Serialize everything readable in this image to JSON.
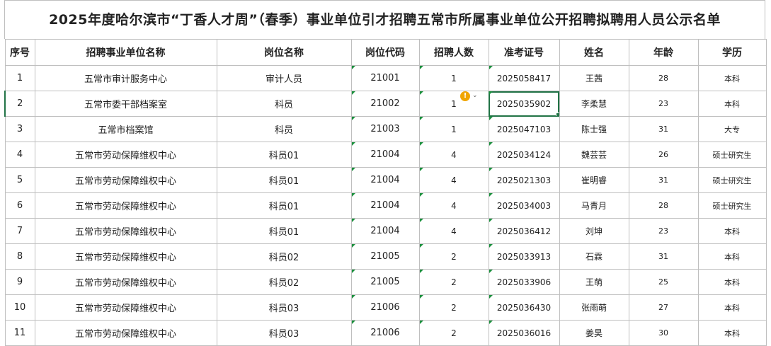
{
  "title": "2025年度哈尔滨市“丁香人才周”（春季）事业单位引才招聘五常市所属事业单位公开招聘拟聘用人员公示名单",
  "headers": [
    "序号",
    "招聘事业单位名称",
    "岗位名称",
    "岗位代码",
    "招聘人数",
    "准考证号",
    "姓名",
    "年龄",
    "学历"
  ],
  "rows": [
    [
      "1",
      "五常市审计服务中心",
      "审计人员",
      "21001",
      "1",
      "2025058417",
      "王茜",
      "28",
      "本科"
    ],
    [
      "2",
      "五常市委干部档案室",
      "科员",
      "21002",
      "1",
      "2025035902",
      "李柔慧",
      "23",
      "本科"
    ],
    [
      "3",
      "五常市档案馆",
      "科员",
      "21003",
      "1",
      "2025047103",
      "陈士强",
      "31",
      "大专"
    ],
    [
      "4",
      "五常市劳动保障维权中心",
      "科员01",
      "21004",
      "4",
      "2025034124",
      "魏芸芸",
      "26",
      "硕士研究生"
    ],
    [
      "5",
      "五常市劳动保障维权中心",
      "科员01",
      "21004",
      "4",
      "2025021303",
      "崔明睿",
      "31",
      "硕士研究生"
    ],
    [
      "6",
      "五常市劳动保障维权中心",
      "科员01",
      "21004",
      "4",
      "2025034003",
      "马青月",
      "28",
      "硕士研究生"
    ],
    [
      "7",
      "五常市劳动保障维权中心",
      "科员01",
      "21004",
      "4",
      "2025036412",
      "刘坤",
      "23",
      "本科"
    ],
    [
      "8",
      "五常市劳动保障维权中心",
      "科员02",
      "21005",
      "2",
      "2025033913",
      "石霖",
      "31",
      "本科"
    ],
    [
      "9",
      "五常市劳动保障维权中心",
      "科员02",
      "21005",
      "2",
      "2025033906",
      "王萌",
      "25",
      "本科"
    ],
    [
      "10",
      "五常市劳动保障维权中心",
      "科员03",
      "21006",
      "2",
      "2025036430",
      "张雨萌",
      "27",
      "本科"
    ],
    [
      "11",
      "五常市劳动保障维权中心",
      "科员03",
      "21006",
      "2",
      "2025036016",
      "姜昊",
      "30",
      "本科"
    ]
  ],
  "warning_icon": "exclamation-circle-icon",
  "warning_glyph": "!",
  "accent_color": "#217346"
}
